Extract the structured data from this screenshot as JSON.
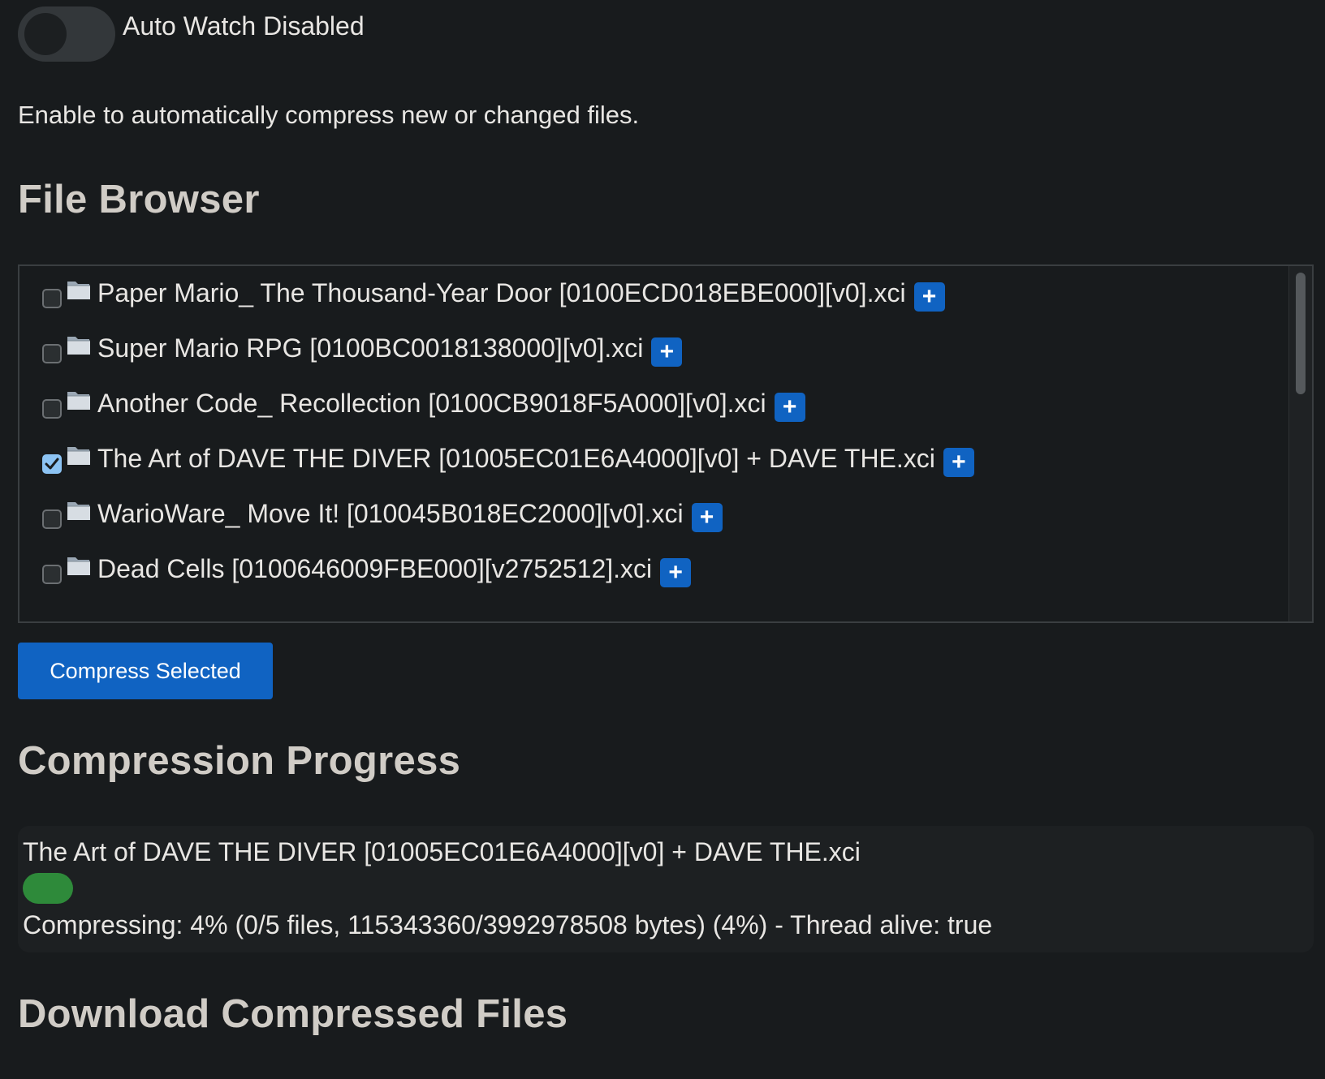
{
  "auto_watch": {
    "label": "Auto Watch Disabled",
    "enabled": false,
    "help": "Enable to automatically compress new or changed files."
  },
  "file_browser": {
    "heading": "File Browser",
    "items": [
      {
        "name": "Paper Mario_ The Thousand-Year Door [0100ECD018EBE000][v0].xci",
        "checked": false,
        "icon": "folder-icon",
        "action": "+"
      },
      {
        "name": "Super Mario RPG [0100BC0018138000][v0].xci",
        "checked": false,
        "icon": "folder-icon",
        "action": "+"
      },
      {
        "name": "Another Code_ Recollection [0100CB9018F5A000][v0].xci",
        "checked": false,
        "icon": "folder-icon",
        "action": "+"
      },
      {
        "name": "The Art of DAVE THE DIVER [01005EC01E6A4000][v0] + DAVE THE.xci",
        "checked": true,
        "icon": "folder-icon",
        "action": "+"
      },
      {
        "name": "WarioWare_ Move It! [010045B018EC2000][v0].xci",
        "checked": false,
        "icon": "folder-icon",
        "action": "+"
      },
      {
        "name": "Dead Cells [0100646009FBE000][v2752512].xci",
        "checked": false,
        "icon": "folder-icon",
        "action": "+"
      }
    ],
    "compress_button": "Compress Selected"
  },
  "compression_progress": {
    "heading": "Compression Progress",
    "file": "The Art of DAVE THE DIVER [01005EC01E6A4000][v0] + DAVE THE.xci",
    "percent": 4,
    "status": "Compressing: 4% (0/5 files, 115343360/3992978508 bytes) (4%) - Thread alive: true"
  },
  "download": {
    "heading": "Download Compressed Files"
  },
  "colors": {
    "background": "#181b1d",
    "accent": "#1063c2",
    "progress": "#2e8a3a",
    "checked": "#8cc3f3"
  }
}
